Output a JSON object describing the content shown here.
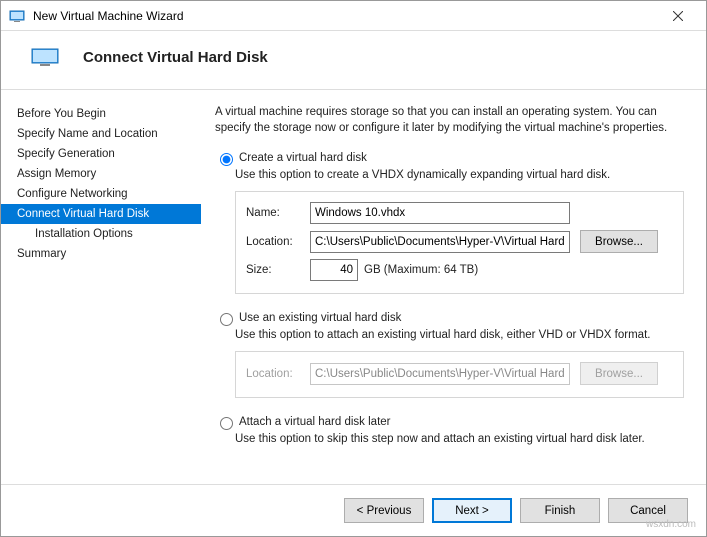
{
  "title": "New Virtual Machine Wizard",
  "header": "Connect Virtual Hard Disk",
  "sidebar": {
    "items": [
      "Before You Begin",
      "Specify Name and Location",
      "Specify Generation",
      "Assign Memory",
      "Configure Networking",
      "Connect Virtual Hard Disk",
      "Installation Options",
      "Summary"
    ]
  },
  "intro": "A virtual machine requires storage so that you can install an operating system. You can specify the storage now or configure it later by modifying the virtual machine's properties.",
  "opt1": {
    "label": "Create a virtual hard disk",
    "desc": "Use this option to create a VHDX dynamically expanding virtual hard disk.",
    "nameLabel": "Name:",
    "nameValue": "Windows 10.vhdx",
    "locLabel": "Location:",
    "locValue": "C:\\Users\\Public\\Documents\\Hyper-V\\Virtual Hard Disks\\",
    "browse": "Browse...",
    "sizeLabel": "Size:",
    "sizeValue": "40",
    "sizeSuffix": "GB (Maximum: 64 TB)"
  },
  "opt2": {
    "label": "Use an existing virtual hard disk",
    "desc": "Use this option to attach an existing virtual hard disk, either VHD or VHDX format.",
    "locLabel": "Location:",
    "locValue": "C:\\Users\\Public\\Documents\\Hyper-V\\Virtual Hard Disks\\",
    "browse": "Browse..."
  },
  "opt3": {
    "label": "Attach a virtual hard disk later",
    "desc": "Use this option to skip this step now and attach an existing virtual hard disk later."
  },
  "footer": {
    "prev": "< Previous",
    "next": "Next >",
    "finish": "Finish",
    "cancel": "Cancel"
  },
  "watermark": "wsxdn.com"
}
